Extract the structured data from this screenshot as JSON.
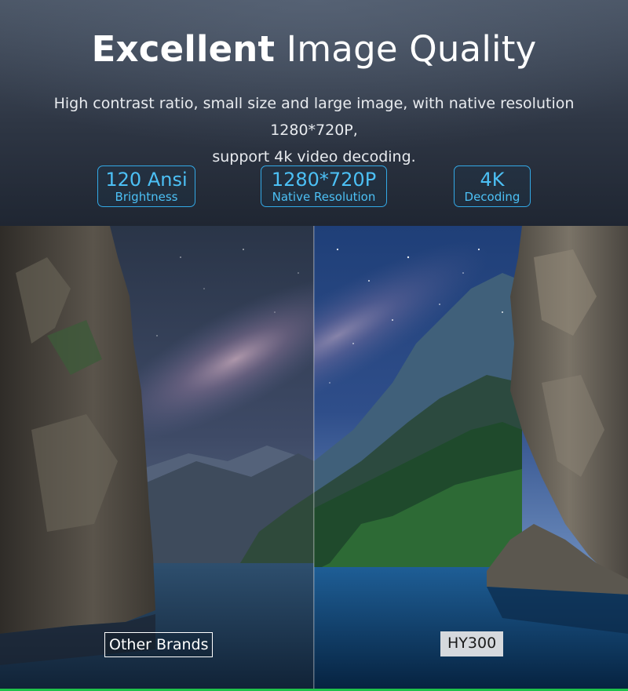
{
  "header": {
    "title_bold": "Excellent",
    "title_light": "Image Quality",
    "subtitle_lines": [
      "High contrast ratio, small size and large image, with native resolution 1280*720P,",
      "support 4k video decoding."
    ]
  },
  "badges": [
    {
      "value": "120 Ansi",
      "caption": "Brightness"
    },
    {
      "value": "1280*720P",
      "caption": "Native Resolution"
    },
    {
      "value": "4K",
      "caption": "Decoding"
    }
  ],
  "comparison": {
    "left_label": "Other Brands",
    "right_label": "HY300"
  },
  "colors": {
    "badge_accent": "#33a9e6",
    "bottom_accent": "#1fc24a"
  }
}
